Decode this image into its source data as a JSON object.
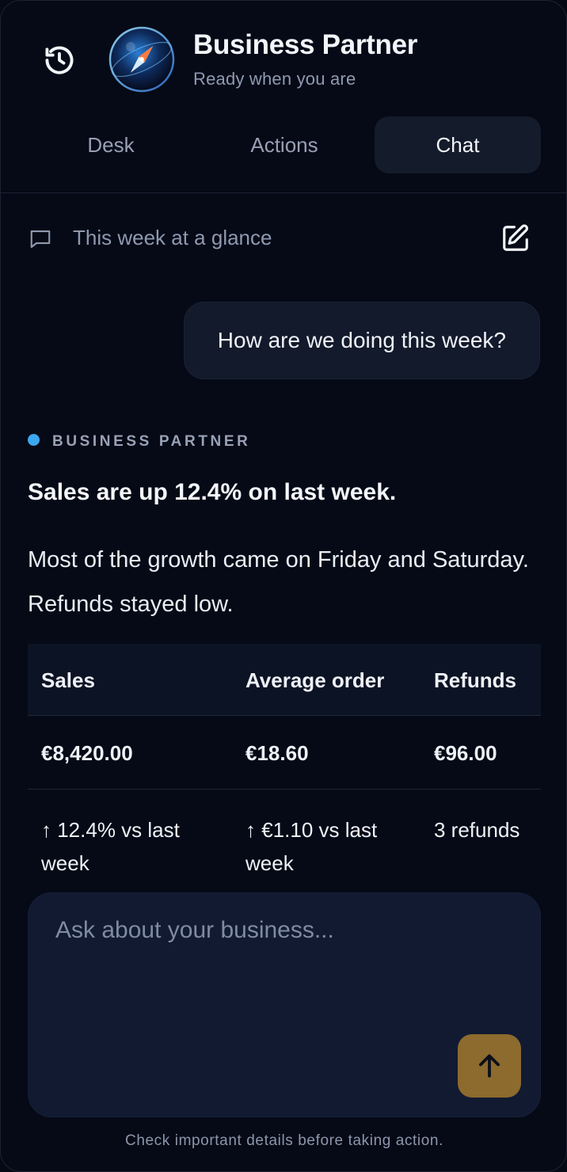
{
  "app": {
    "title": "Business Partner",
    "status": "Ready when you are"
  },
  "icons": {
    "history": "history-icon",
    "avatar": "compass-orb-icon",
    "conversation": "chat-bubble-icon",
    "new_chat": "edit-square-icon",
    "send": "arrow-up-icon"
  },
  "tabs": [
    {
      "label": "Desk",
      "active": false
    },
    {
      "label": "Actions",
      "active": false
    },
    {
      "label": "Chat",
      "active": true
    }
  ],
  "conversation": {
    "title": "This week at a glance"
  },
  "messages": {
    "user": "How are we doing this week?",
    "assistant": {
      "label": "BUSINESS PARTNER",
      "headline": "Sales are up 12.4% on last week.",
      "body": "Most of the growth came on Friday and Saturday. Refunds stayed low."
    }
  },
  "metrics": {
    "columns": [
      "Sales",
      "Average order",
      "Refunds"
    ],
    "values": [
      "€8,420.00",
      "€18.60",
      "€96.00"
    ],
    "changes": [
      "↑ 12.4% vs last week",
      "↑ €1.10 vs last week",
      "3 refunds"
    ]
  },
  "composer": {
    "placeholder": "Ask about your business..."
  },
  "footer": {
    "disclaimer": "Check important details before taking action."
  },
  "colors": {
    "background": "#060a16",
    "accent_dot": "#3ba7ef",
    "send_button": "#8d6a2d"
  }
}
